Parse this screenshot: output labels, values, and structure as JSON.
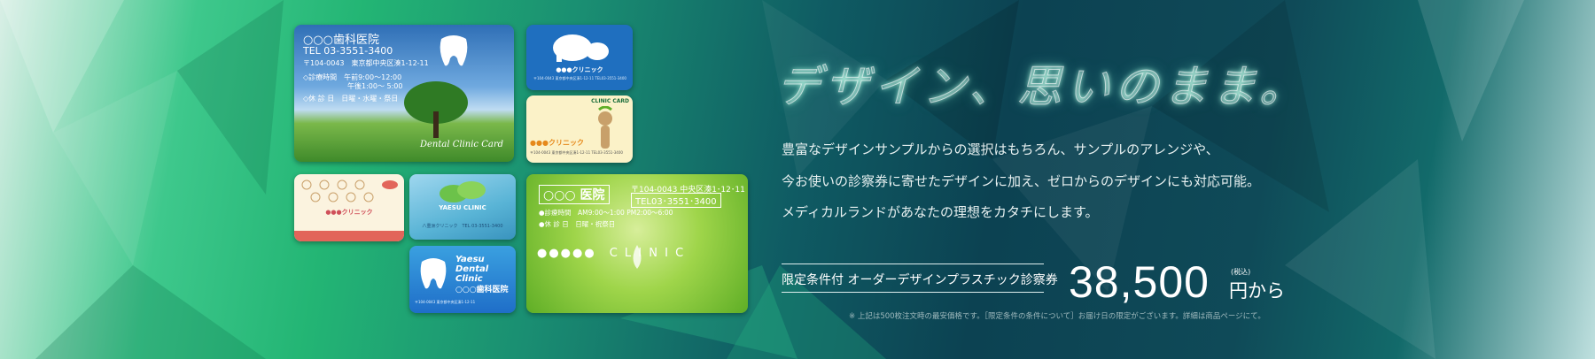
{
  "cards": {
    "card1": {
      "clinic_name": "○○○歯科医院",
      "tel": "TEL 03-3551-3400",
      "address": "〒104-0043　東京都中央区湊1-12-11",
      "hours_am": "◇診療時間　午前9:00～12:00",
      "hours_pm": "午後1:00～ 5:00",
      "closed": "◇休 診 日　日曜・水曜・祭日",
      "card_label": "Dental Clinic Card"
    },
    "card2": {
      "clinic_name": "●●●クリニック",
      "fine_print": "〒104-0043 東京都中央区湊1-12-11 TEL03-3551-3400"
    },
    "card3": {
      "header": "CLINIC CARD",
      "clinic_name": "●●●クリニック",
      "fine_print": "〒104-0043 東京都中央区湊1-12-11 TEL03-3551-3400"
    },
    "card4": {
      "clinic_name": "●●●クリニック"
    },
    "card5": {
      "clinic_name": "YAESU CLINIC",
      "fine_print": "八重洲クリニック　TEL 03-3551-3400"
    },
    "card6": {
      "clinic_name_en": "Yaesu Dental Clinic",
      "clinic_name_jp": "○○○歯科医院",
      "fine_print": "〒104-0043 東京都中央区湊1-12-11"
    },
    "card7": {
      "clinic_name": "○○○ 医院",
      "address": "〒104-0043 中央区湊1･12･11",
      "tel": "TEL03･3551･3400",
      "hours": "●診療時間　AM9:00～1:00 PM2:00～6:00",
      "closed": "●休 診 日　日曜・祝祭日",
      "logo": "●●●●●　C L I N I C"
    }
  },
  "headline": "デザイン、思いのまま。",
  "description": [
    "豊富なデザインサンプルからの選択はもちろん、サンプルのアレンジや、",
    "今お使いの診察券に寄せたデザインに加え、ゼロからのデザインにも対応可能。",
    "メディカルランドがあなたの理想をカタチにします。"
  ],
  "promo": {
    "label": "限定条件付 オーダーデザインプラスチック診察券",
    "price": "38,500",
    "tax_note": "(税込)",
    "price_suffix": "円から",
    "footnote": "※ 上記は500枚注文時の最安価格です。［限定条件の条件について］お届け日の限定がございます。詳細は商品ページにて。"
  },
  "colors": {
    "accent": "#23b574",
    "dark": "#0c4252",
    "text_light": "#e8f1f1"
  }
}
